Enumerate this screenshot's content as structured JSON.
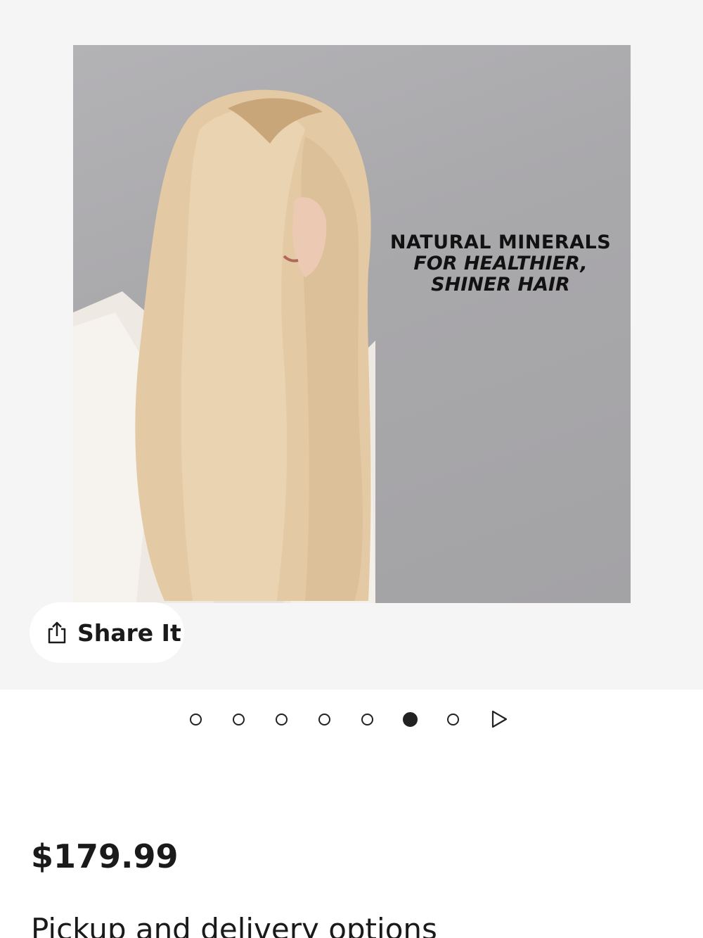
{
  "gallery": {
    "image": {
      "overlay_line1": "NATURAL MINERALS",
      "overlay_line2": "FOR HEALTHIER,",
      "overlay_line3": "SHINER HAIR"
    },
    "share_label": "Share It",
    "pagination": {
      "count": 7,
      "active_index": 5,
      "next_icon": "play-triangle-icon"
    }
  },
  "product": {
    "price": "$179.99",
    "pickup_heading": "Pickup and delivery options"
  }
}
